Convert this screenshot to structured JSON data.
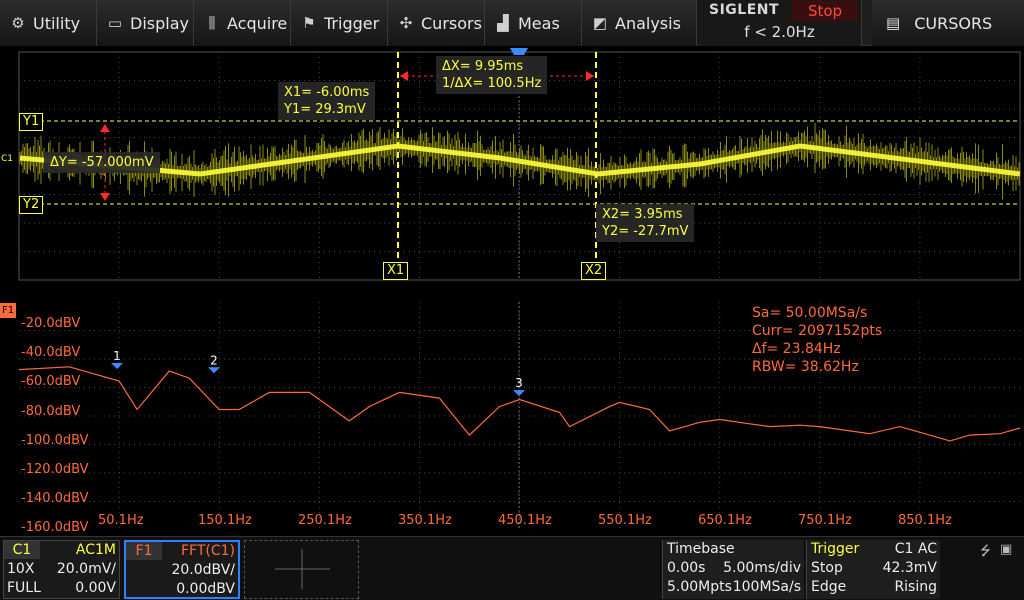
{
  "menu": {
    "utility": "Utility",
    "display": "Display",
    "acquire": "Acquire",
    "trigger": "Trigger",
    "cursors": "Cursors",
    "meas": "Meas",
    "analysis": "Analysis"
  },
  "brand": {
    "logo": "SIGLENT",
    "run_state": "Stop",
    "trigger_freq": "f < 2.0Hz"
  },
  "panel_title": "CURSORS",
  "cursors": {
    "x1": {
      "tag": "X1",
      "time": "X1= -6.00ms",
      "volt": "Y1= 29.3mV"
    },
    "x2": {
      "tag": "X2",
      "time": "X2= 3.95ms",
      "volt": "Y2= -27.7mV"
    },
    "delta_x": "ΔX= 9.95ms",
    "inv_delta_x": "1/ΔX= 100.5Hz",
    "delta_y": "ΔY= -57.000mV",
    "y1_tag": "Y1",
    "y2_tag": "Y2",
    "channel_marker": "C1"
  },
  "fft": {
    "label": "F1",
    "y_ticks": [
      "-20.0dBV",
      "-40.0dBV",
      "-60.0dBV",
      "-80.0dBV",
      "-100.0dBV",
      "-120.0dBV",
      "-140.0dBV",
      "-160.0dBV"
    ],
    "x_ticks": [
      "50.1Hz",
      "150.1Hz",
      "250.1Hz",
      "350.1Hz",
      "450.1Hz",
      "550.1Hz",
      "650.1Hz",
      "750.1Hz",
      "850.1Hz"
    ],
    "info": {
      "sa": "Sa=  50.00MSa/s",
      "curr": "Curr= 2097152pts",
      "df": "Δf=  23.84Hz",
      "rbw": "RBW=  38.62Hz"
    },
    "peak_markers": [
      "1",
      "2",
      "3"
    ]
  },
  "bottom": {
    "c1": {
      "name": "C1",
      "coupling": "AC1M",
      "probe": "10X",
      "scale": "20.0mV/",
      "bw": "FULL",
      "offset": "0.00V"
    },
    "f1": {
      "name": "F1",
      "source": "FFT(C1)",
      "scale": "20.0dBV/",
      "offset": "0.00dBV"
    },
    "timebase": {
      "title": "Timebase",
      "delay": "0.00s",
      "scale": "5.00ms/div",
      "depth": "5.00Mpts",
      "rate": "100MSa/s"
    },
    "trigger": {
      "title": "Trigger",
      "source": "C1 AC",
      "state": "Stop",
      "level": "42.3mV",
      "type": "Edge",
      "slope": "Rising"
    }
  },
  "colors": {
    "ch1": "#ffff3c",
    "fft": "#ff6a3c",
    "marker": "#3d8bff",
    "stop": "#ff4a3a",
    "f1_frame": "#2f7fff"
  }
}
